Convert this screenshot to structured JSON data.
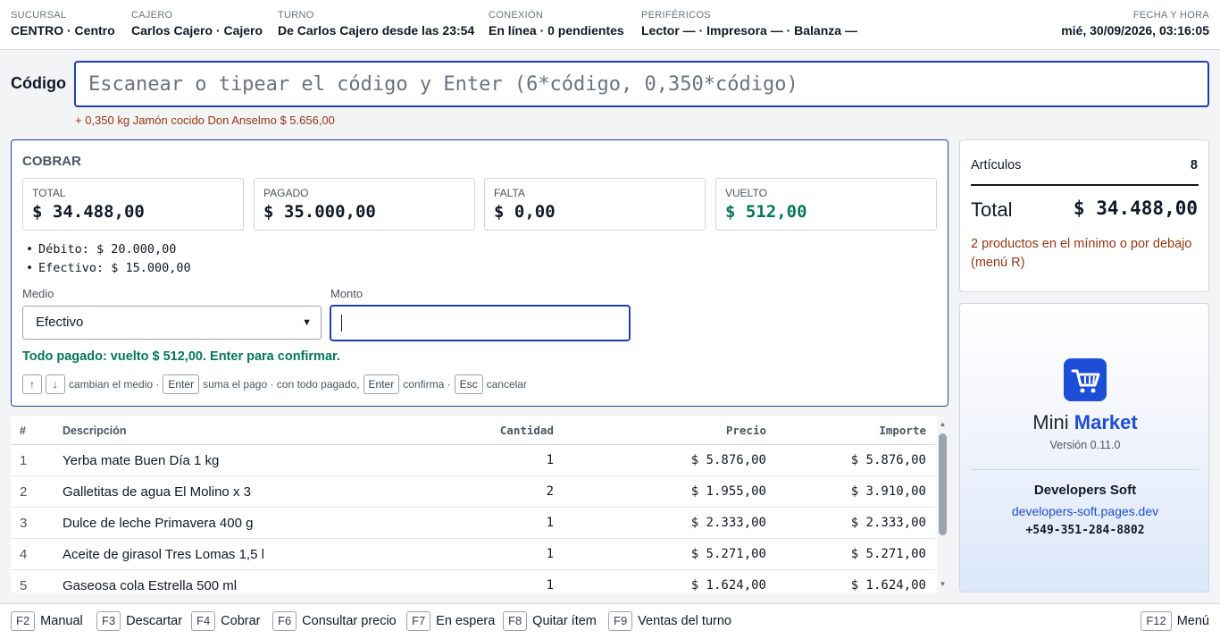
{
  "status": {
    "sucursal": {
      "label": "SUCURSAL",
      "value": "CENTRO · Centro"
    },
    "cajero": {
      "label": "CAJERO",
      "value": "Carlos Cajero · Cajero"
    },
    "turno": {
      "label": "TURNO",
      "value": "De Carlos Cajero desde las 23:54"
    },
    "conexion": {
      "label": "CONEXIÓN",
      "value": "En línea · 0 pendientes"
    },
    "perifericos": {
      "label": "PERIFÉRICOS",
      "value": "Lector — · Impresora — · Balanza —"
    },
    "fecha": {
      "label": "FECHA Y HORA",
      "value": "mié, 30/09/2026, 03:16:05"
    }
  },
  "code": {
    "label": "Código",
    "placeholder": "Escanear o tipear el código y Enter (6*código, 0,350*código)",
    "last_added": "+ 0,350 kg Jamón cocido Don Anselmo $ 5.656,00"
  },
  "cobrar": {
    "title": "COBRAR",
    "total": {
      "label": "TOTAL",
      "value": "$ 34.488,00"
    },
    "pagado": {
      "label": "PAGADO",
      "value": "$ 35.000,00"
    },
    "falta": {
      "label": "FALTA",
      "value": "$ 0,00"
    },
    "vuelto": {
      "label": "VUELTO",
      "value": "$ 512,00"
    },
    "pagos": [
      "Débito: $ 20.000,00",
      "Efectivo: $ 15.000,00"
    ],
    "medio_label": "Medio",
    "medio_value": "Efectivo",
    "monto_label": "Monto",
    "monto_value": "",
    "ok_message": "Todo pagado: vuelto $ 512,00. Enter para confirmar.",
    "hints": {
      "up": "↑",
      "down": "↓",
      "t1": "cambian el medio ·",
      "enter1": "Enter",
      "t2": "suma el pago · con todo pagado,",
      "enter2": "Enter",
      "t3": "confirma ·",
      "esc": "Esc",
      "t4": "cancelar"
    },
    "accent_color": "#1e40af",
    "ok_color": "#047857"
  },
  "table": {
    "headers": {
      "num": "#",
      "desc": "Descripción",
      "qty": "Cantidad",
      "price": "Precio",
      "amount": "Importe"
    },
    "rows": [
      {
        "num": "1",
        "desc": "Yerba mate Buen Día 1 kg",
        "qty": "1",
        "price": "$ 5.876,00",
        "amount": "$ 5.876,00"
      },
      {
        "num": "2",
        "desc": "Galletitas de agua El Molino x 3",
        "qty": "2",
        "price": "$ 1.955,00",
        "amount": "$ 3.910,00"
      },
      {
        "num": "3",
        "desc": "Dulce de leche Primavera 400 g",
        "qty": "1",
        "price": "$ 2.333,00",
        "amount": "$ 2.333,00"
      },
      {
        "num": "4",
        "desc": "Aceite de girasol Tres Lomas 1,5 l",
        "qty": "1",
        "price": "$ 5.271,00",
        "amount": "$ 5.271,00"
      },
      {
        "num": "5",
        "desc": "Gaseosa cola Estrella 500 ml",
        "qty": "1",
        "price": "$ 1.624,00",
        "amount": "$ 1.624,00"
      }
    ]
  },
  "summary": {
    "articulos_label": "Artículos",
    "articulos_value": "8",
    "total_label": "Total",
    "total_value": "$ 34.488,00",
    "warning": "2 productos en el mínimo o por debajo (menú R)"
  },
  "brand": {
    "icon": "shopping-cart-icon",
    "name_a": "Mini",
    "name_b": "Market",
    "version": "Versión 0.11.0",
    "dev": "Developers Soft",
    "url": "developers-soft.pages.dev",
    "phone": "+549-351-284-8802"
  },
  "fkeys": [
    {
      "key": "F2",
      "label": "Manual"
    },
    {
      "key": "F3",
      "label": "Descartar"
    },
    {
      "key": "F4",
      "label": "Cobrar"
    },
    {
      "key": "F6",
      "label": "Consultar precio"
    },
    {
      "key": "F7",
      "label": "En espera"
    },
    {
      "key": "F8",
      "label": "Quitar ítem"
    },
    {
      "key": "F9",
      "label": "Ventas del turno"
    },
    {
      "key": "F12",
      "label": "Menú"
    }
  ]
}
